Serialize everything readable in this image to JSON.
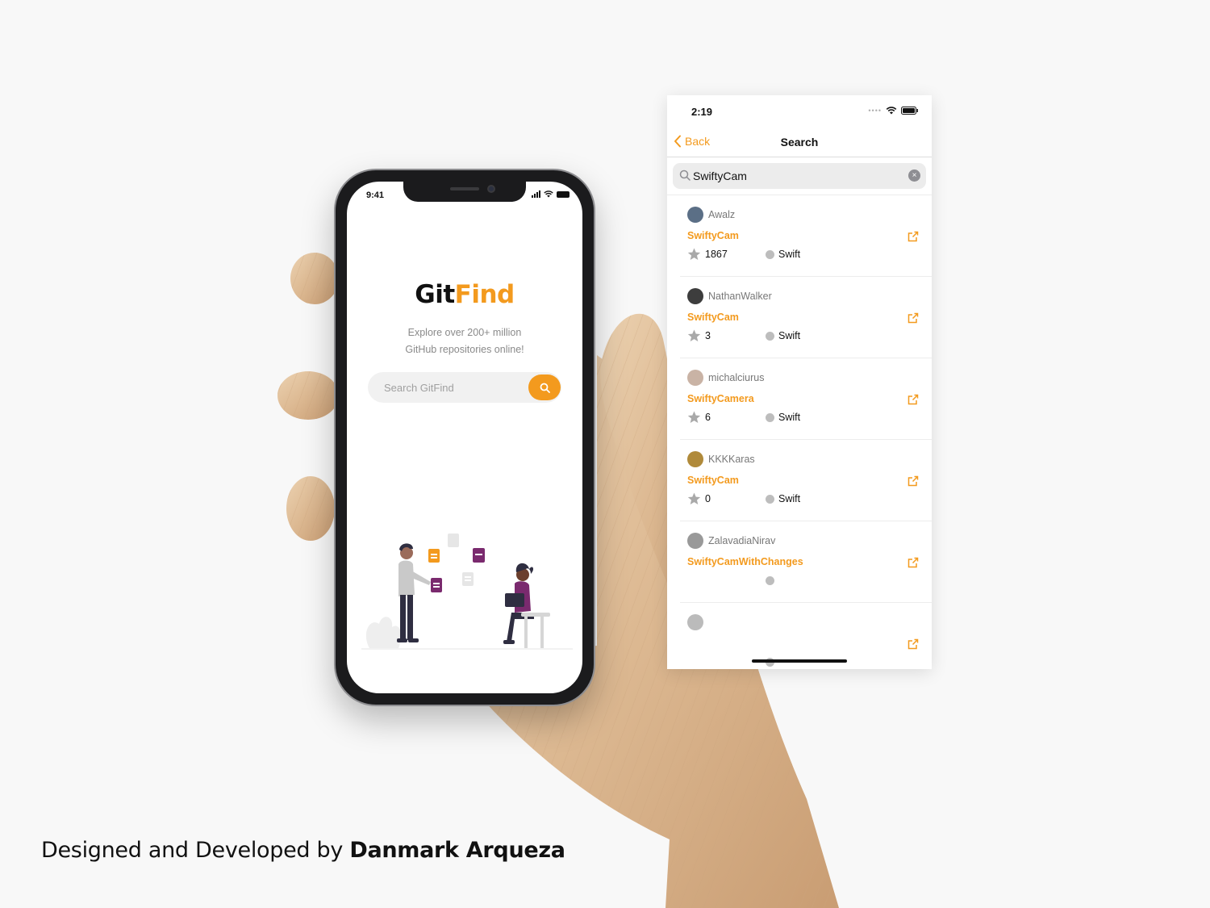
{
  "phone": {
    "time": "9:41",
    "brand_first": "Git",
    "brand_second": "Find",
    "tagline_line1": "Explore over 200+ million",
    "tagline_line2": "GitHub repositories online!",
    "search_placeholder": "Search GitFind"
  },
  "search_screen": {
    "time": "2:19",
    "back_label": "Back",
    "title": "Search",
    "query": "SwiftyCam",
    "results": [
      {
        "user": "Awalz",
        "repo": "SwiftyCam",
        "stars": "1867",
        "language": "Swift"
      },
      {
        "user": "NathanWalker",
        "repo": "SwiftyCam",
        "stars": "3",
        "language": "Swift"
      },
      {
        "user": "michalciurus",
        "repo": "SwiftyCamera",
        "stars": "6",
        "language": "Swift"
      },
      {
        "user": "KKKKaras",
        "repo": "SwiftyCam",
        "stars": "0",
        "language": "Swift"
      },
      {
        "user": "ZalavadiaNirav",
        "repo": "SwiftyCamWithChanges",
        "stars": "",
        "language": ""
      },
      {
        "user": "",
        "repo": "",
        "stars": "",
        "language": ""
      }
    ]
  },
  "credit": {
    "prefix": "Designed and Developed by ",
    "author": "Danmark Arqueza"
  },
  "colors": {
    "accent": "#f39a1e",
    "background": "#f8f8f8",
    "wood": "#dcbb95"
  }
}
